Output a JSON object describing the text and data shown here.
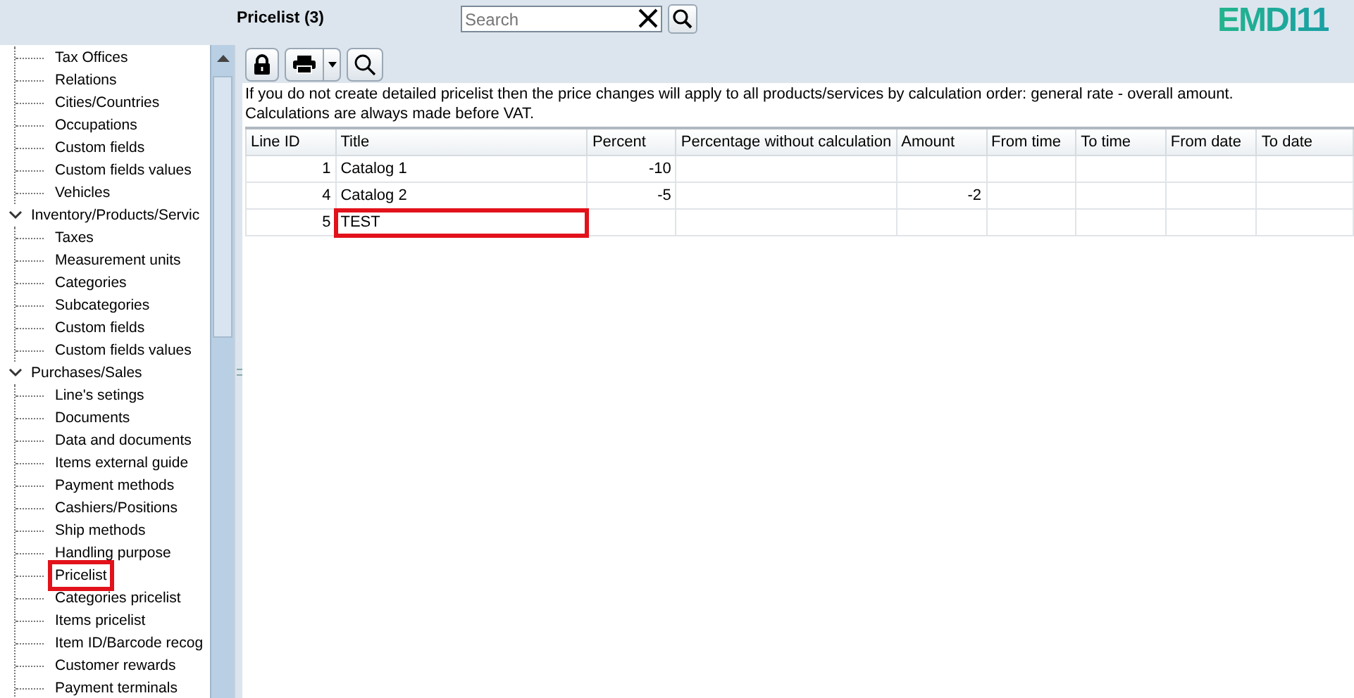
{
  "header": {
    "title": "Pricelist (3)",
    "search": {
      "placeholder": "Search"
    },
    "logo": "EMDI11"
  },
  "tree": [
    {
      "children": [
        {
          "label": "Tax Offices",
          "highlighted": false
        },
        {
          "label": "Relations",
          "highlighted": false
        },
        {
          "label": "Cities/Countries",
          "highlighted": false
        },
        {
          "label": "Occupations",
          "highlighted": false
        },
        {
          "label": "Custom fields",
          "highlighted": false
        },
        {
          "label": "Custom fields values",
          "highlighted": false
        },
        {
          "label": "Vehicles",
          "highlighted": false
        }
      ]
    },
    {
      "label": "Inventory/Products/Servic",
      "expanded": true,
      "children": [
        {
          "label": "Taxes",
          "highlighted": false
        },
        {
          "label": "Measurement units",
          "highlighted": false
        },
        {
          "label": "Categories",
          "highlighted": false
        },
        {
          "label": "Subcategories",
          "highlighted": false
        },
        {
          "label": "Custom fields",
          "highlighted": false
        },
        {
          "label": "Custom fields values",
          "highlighted": false
        }
      ]
    },
    {
      "label": "Purchases/Sales",
      "expanded": true,
      "children": [
        {
          "label": "Line's setings",
          "highlighted": false
        },
        {
          "label": "Documents",
          "highlighted": false
        },
        {
          "label": "Data and documents",
          "highlighted": false
        },
        {
          "label": "Items external guide",
          "highlighted": false
        },
        {
          "label": "Payment methods",
          "highlighted": false
        },
        {
          "label": "Cashiers/Positions",
          "highlighted": false
        },
        {
          "label": "Ship methods",
          "highlighted": false
        },
        {
          "label": "Handling purpose",
          "highlighted": false
        },
        {
          "label": "Pricelist",
          "highlighted": true
        },
        {
          "label": "Categories pricelist",
          "highlighted": false
        },
        {
          "label": "Items pricelist",
          "highlighted": false
        },
        {
          "label": "Item ID/Barcode recog",
          "highlighted": false
        },
        {
          "label": "Customer rewards",
          "highlighted": false
        },
        {
          "label": "Payment terminals",
          "highlighted": false
        }
      ]
    }
  ],
  "info": [
    "If you do not create detailed pricelist then the price changes will apply to all products/services by calculation order: general rate - overall amount.",
    "Calculations are always made before VAT."
  ],
  "table": {
    "columns": [
      "Line ID",
      "Title",
      "Percent",
      "Percentage without calculation",
      "Amount",
      "From time",
      "To time",
      "From date",
      "To date"
    ],
    "rows": [
      {
        "cells": [
          "1",
          "Catalog 1",
          "-10",
          "",
          "",
          "",
          "",
          "",
          ""
        ],
        "highlighted": false
      },
      {
        "cells": [
          "4",
          "Catalog 2",
          "-5",
          "",
          "-2",
          "",
          "",
          "",
          ""
        ],
        "highlighted": false
      },
      {
        "cells": [
          "5",
          "TEST",
          "",
          "",
          "",
          "",
          "",
          "",
          ""
        ],
        "highlighted": true
      }
    ]
  }
}
